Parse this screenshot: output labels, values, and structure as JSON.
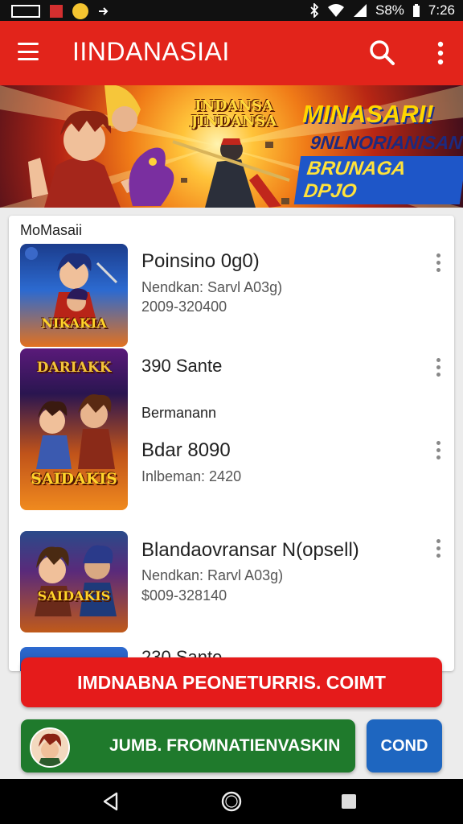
{
  "status_bar": {
    "battery": "S8%",
    "time": "7:26",
    "icons": [
      "screenshot-icon",
      "notification-icon",
      "emoji-icon",
      "arrow-icon",
      "bluetooth-icon",
      "wifi-icon",
      "signal-icon",
      "battery-icon"
    ]
  },
  "app_bar": {
    "title": "IINDANASIAI",
    "icons": [
      "menu-icon",
      "search-icon",
      "more-vert-icon"
    ]
  },
  "banner": {
    "logo": "INDANSA JINDANSA",
    "headline": "MINASARI!",
    "subline": "9NLNORIANISAN",
    "badge": "BRUNAGA DPJO"
  },
  "list": {
    "section_title": "MoMasaii",
    "items": [
      {
        "title": "Poinsino 0g0)",
        "line1": "Nendkan: Sarvl A03g)",
        "line2": "2009-320400",
        "thumb_text": "NIKAKIA"
      },
      {
        "title": "390 Sante",
        "line1": "",
        "line2": ""
      },
      {
        "title": "Bermanann",
        "line1": "",
        "line2": ""
      },
      {
        "title": "Bdar 8090",
        "line1": "Inlbeman: 2420",
        "line2": "",
        "thumb_text": "SAIDAKIS",
        "thumb_top_text": "DARIAKK"
      },
      {
        "title": "Blandaovransar N(opsell)",
        "line1": "Nendkan: Rarvl A03g)",
        "line2": "$009-328140",
        "thumb_text": "SAIDAKIS"
      },
      {
        "title": "230 Sante",
        "line1": "",
        "line2": ""
      }
    ]
  },
  "actions": {
    "primary": "IMDNABNA PEONETURRIS. COIMT",
    "secondary": "JUMB. FROMNATIENVASKIN",
    "tertiary": "COND"
  },
  "colors": {
    "app_bar": "#e2241b",
    "primary_button": "#e51b1b",
    "secondary_button": "#1f7a2c",
    "tertiary_button": "#1e66c0"
  },
  "nav_bar": {
    "icons": [
      "back-icon",
      "home-icon",
      "recents-icon"
    ]
  }
}
